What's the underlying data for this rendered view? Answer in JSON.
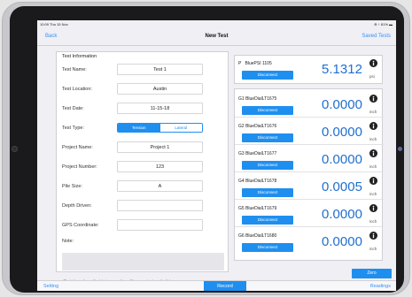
{
  "status": {
    "time": "10:09  Thu 15 Nov",
    "battery": "⊕ ↑ 81% ▬"
  },
  "nav": {
    "back_label": "Back",
    "title": "New Test",
    "saved_tests_label": "Saved Tests"
  },
  "form": {
    "section_title": "Test Information",
    "fields": [
      {
        "label": "Test Name:",
        "value": "Test 1"
      },
      {
        "label": "Test Location:",
        "value": "Austin"
      },
      {
        "label": "Test Date:",
        "value": "11-15-18"
      }
    ],
    "test_type": {
      "label": "Test Type:",
      "options": [
        "Tension",
        "Lateral"
      ],
      "selected": "Tension"
    },
    "fields2": [
      {
        "label": "Project Name:",
        "value": "Project 1"
      },
      {
        "label": "Project Number:",
        "value": "123"
      },
      {
        "label": "Pile Size:",
        "value": "A"
      },
      {
        "label": "Depth Driven:",
        "value": ""
      },
      {
        "label": "GPS Coordinate:",
        "value": ""
      }
    ],
    "note_label": "Note:",
    "footnote": "(Test information edited during recording will be saved automatically)"
  },
  "pressure": {
    "name_prefix": "P",
    "name": "BluePSI 1105",
    "button": "Disconnect",
    "value": "5.1312",
    "unit": "psi"
  },
  "gauges": [
    {
      "id": "G1",
      "name": "BlueDialLT1675",
      "button": "Disconnect",
      "value": "0.0000",
      "unit": "inch"
    },
    {
      "id": "G2",
      "name": "BlueDialLT1676",
      "button": "Disconnect",
      "value": "0.0000",
      "unit": "inch"
    },
    {
      "id": "G3",
      "name": "BlueDialLT1677",
      "button": "Disconnect",
      "value": "0.0000",
      "unit": "inch"
    },
    {
      "id": "G4",
      "name": "BlueDialLT1678",
      "button": "Disconnect",
      "value": "0.0005",
      "unit": "inch"
    },
    {
      "id": "G5",
      "name": "BlueDialLT1679",
      "button": "Disconnect",
      "value": "0.0000",
      "unit": "inch"
    },
    {
      "id": "G6",
      "name": "BlueDialLT1680",
      "button": "Disconnect",
      "value": "0.0000",
      "unit": "inch"
    }
  ],
  "zero_label": "Zero",
  "tabbar": {
    "setting_label": "Setting",
    "record_label": "Record",
    "readings_label": "Readings"
  },
  "colors": {
    "accent": "#1f8fef",
    "value_text": "#1f6fd0",
    "link": "#3a8ff5"
  },
  "icons": {
    "info": "info-icon"
  }
}
